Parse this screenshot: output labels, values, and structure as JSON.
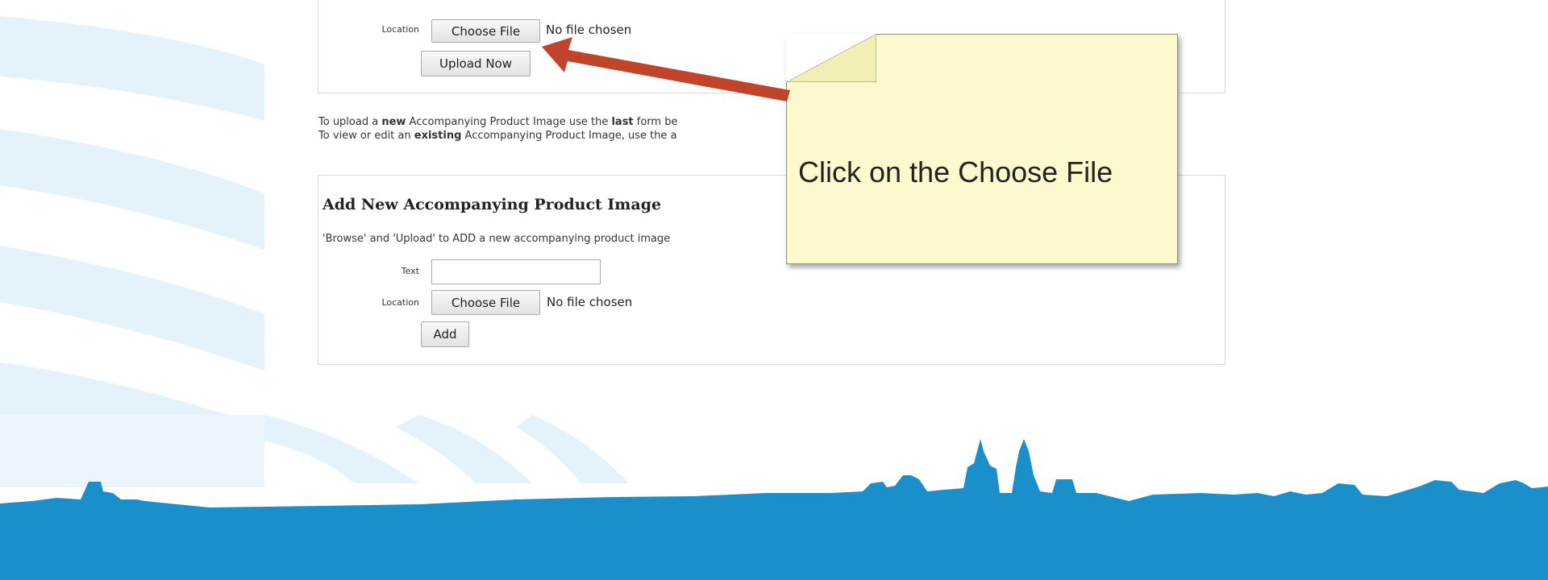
{
  "upload_section": {
    "location_label": "Location",
    "choose_file_label": "Choose File",
    "file_status": "No file chosen",
    "upload_button_label": "Upload Now"
  },
  "instructions": {
    "line1": {
      "prefix": "To upload a ",
      "bold1": "new",
      "middle": " Accompanying Product Image use the ",
      "bold2": "last",
      "suffix": " form be"
    },
    "line2": {
      "prefix": "To view or edit an ",
      "bold1": "existing",
      "suffix": " Accompanying Product Image, use the a"
    }
  },
  "add_section": {
    "title": "Add New Accompanying Product Image",
    "description": "'Browse' and 'Upload' to ADD a new accompanying product image",
    "text_label": "Text",
    "text_value": "",
    "location_label": "Location",
    "choose_file_label": "Choose File",
    "file_status": "No file chosen",
    "add_button_label": "Add"
  },
  "callout": {
    "text": "Click on the Choose File"
  },
  "colors": {
    "skyline_blue": "#1b8fc9",
    "arc_blue": "#dff1fb",
    "arrow_red": "#c0442a",
    "callout_fill": "#fdf9cf"
  }
}
